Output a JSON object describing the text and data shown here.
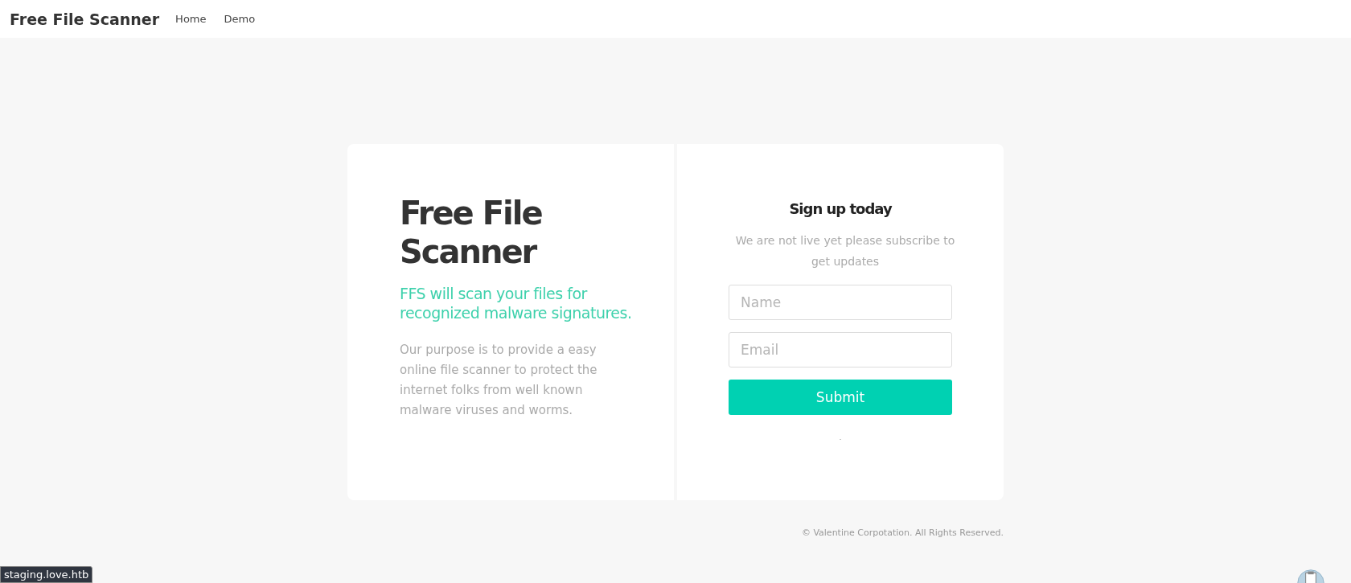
{
  "navbar": {
    "brand": "Free File Scanner",
    "links": [
      {
        "label": "Home"
      },
      {
        "label": "Demo"
      }
    ]
  },
  "intro": {
    "title": "Free File Scanner",
    "tagline": "FFS will scan your files for recognized malware signatures.",
    "description": "Our purpose is to provide a easy online file scanner to protect the internet folks from well known malware viruses and worms."
  },
  "signup": {
    "title": "Sign up today",
    "subtitle": "We are not live yet please subscribe to get updates",
    "fields": [
      {
        "placeholder": "Name"
      },
      {
        "placeholder": "Email"
      }
    ],
    "submit": "Submit",
    "message": "."
  },
  "footer": {
    "copyright": "© Valentine Corpotation. All Rights Reserved."
  },
  "status_bar": {
    "url": "staging.love.htb"
  }
}
